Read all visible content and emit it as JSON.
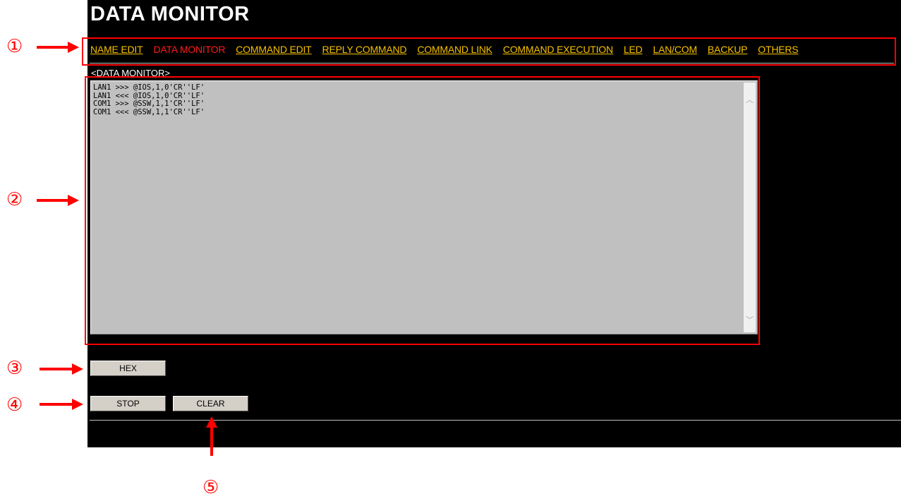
{
  "header": {
    "title": "DATA MONITOR"
  },
  "nav": {
    "items": [
      {
        "label": "NAME EDIT",
        "active": false
      },
      {
        "label": "DATA MONITOR",
        "active": true
      },
      {
        "label": "COMMAND EDIT",
        "active": false
      },
      {
        "label": "REPLY COMMAND",
        "active": false
      },
      {
        "label": "COMMAND LINK",
        "active": false
      },
      {
        "label": "COMMAND EXECUTION",
        "active": false
      },
      {
        "label": "LED",
        "active": false
      },
      {
        "label": "LAN/COM",
        "active": false
      },
      {
        "label": "BACKUP",
        "active": false
      },
      {
        "label": "OTHERS",
        "active": false
      }
    ]
  },
  "section": {
    "label": "<DATA MONITOR>"
  },
  "monitor": {
    "lines": [
      "LAN1 >>> @IOS,1,0'CR''LF'",
      "LAN1 <<< @IOS,1,0'CR''LF'",
      "COM1 >>> @SSW,1,1'CR''LF'",
      "COM1 <<< @SSW,1,1'CR''LF'"
    ]
  },
  "buttons": {
    "hex": "HEX",
    "stop": "STOP",
    "clear": "CLEAR"
  },
  "annotations": {
    "m1": "①",
    "m2": "②",
    "m3": "③",
    "m4": "④",
    "m5": "⑤"
  },
  "colors": {
    "nav_link": "#f5c000",
    "nav_active": "#ff1a1a",
    "annotation": "#ff0000",
    "monitor_bg": "#c0c0c0"
  }
}
